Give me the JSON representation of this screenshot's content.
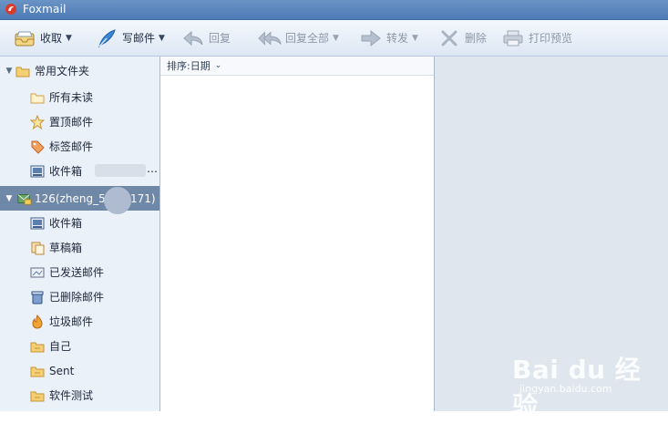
{
  "window": {
    "title": "Foxmail"
  },
  "colors": {
    "titlebar": "#4e7bb6",
    "selection": "#6f88a8",
    "folder": "#f0b84a"
  },
  "toolbar": {
    "receive_label": "收取",
    "compose_label": "写邮件",
    "reply_label": "回复",
    "reply_all_label": "回复全部",
    "forward_label": "转发",
    "delete_label": "删除",
    "print_preview_label": "打印预览"
  },
  "folders": {
    "common": {
      "group_label": "常用文件夹",
      "items": [
        "所有未读",
        "置顶邮件",
        "标签邮件",
        "收件箱"
      ]
    },
    "account": {
      "label": "126(zheng_5",
      "label_suffix": "171)",
      "items": [
        "收件箱",
        "草稿箱",
        "已发送邮件",
        "已删除邮件",
        "垃圾邮件",
        "自己",
        "Sent",
        "软件测试"
      ]
    }
  },
  "list": {
    "sort_label": "排序:日期"
  },
  "watermark": {
    "brand": "Bai du 经验",
    "url": "jingyan.baidu.com"
  }
}
